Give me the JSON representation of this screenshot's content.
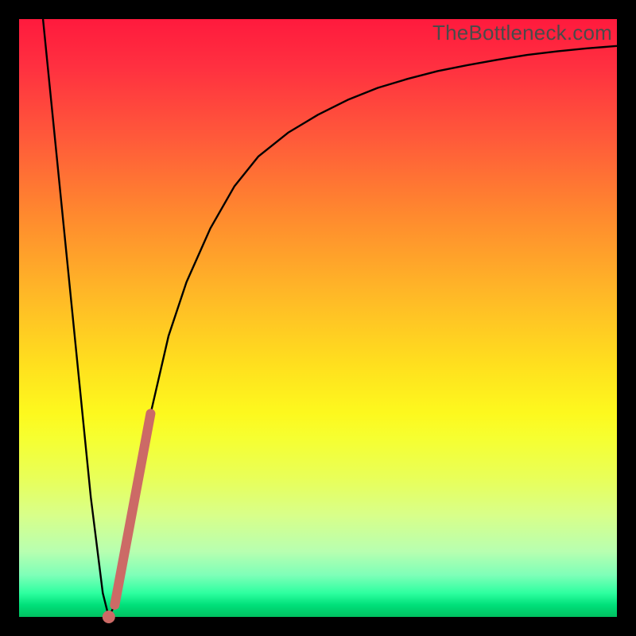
{
  "watermark": "TheBottleneck.com",
  "chart_data": {
    "type": "line",
    "title": "",
    "xlabel": "",
    "ylabel": "",
    "xlim": [
      0,
      100
    ],
    "ylim": [
      0,
      100
    ],
    "grid": false,
    "series": [
      {
        "name": "curve",
        "x": [
          4,
          6,
          8,
          10,
          12,
          14,
          15,
          16,
          17,
          18,
          20,
          22,
          25,
          28,
          32,
          36,
          40,
          45,
          50,
          55,
          60,
          65,
          70,
          75,
          80,
          85,
          90,
          95,
          100
        ],
        "values": [
          100,
          80,
          60,
          40,
          20,
          4,
          0,
          2,
          6,
          12,
          24,
          34,
          47,
          56,
          65,
          72,
          77,
          81,
          84,
          86.5,
          88.5,
          90,
          91.3,
          92.3,
          93.2,
          94,
          94.6,
          95.1,
          95.5
        ]
      }
    ],
    "annotations": [
      {
        "name": "highlight-segment",
        "type": "line-segment",
        "x": [
          16,
          22
        ],
        "values": [
          2,
          34
        ],
        "color": "#cc6a66",
        "width": 12
      },
      {
        "name": "highlight-dot",
        "type": "point",
        "x": 15,
        "y": 0,
        "color": "#cc6a66",
        "radius": 8
      }
    ],
    "background_gradient": {
      "top": "#ff1a3d",
      "mid": "#ffe01e",
      "bottom": "#00c060"
    }
  }
}
